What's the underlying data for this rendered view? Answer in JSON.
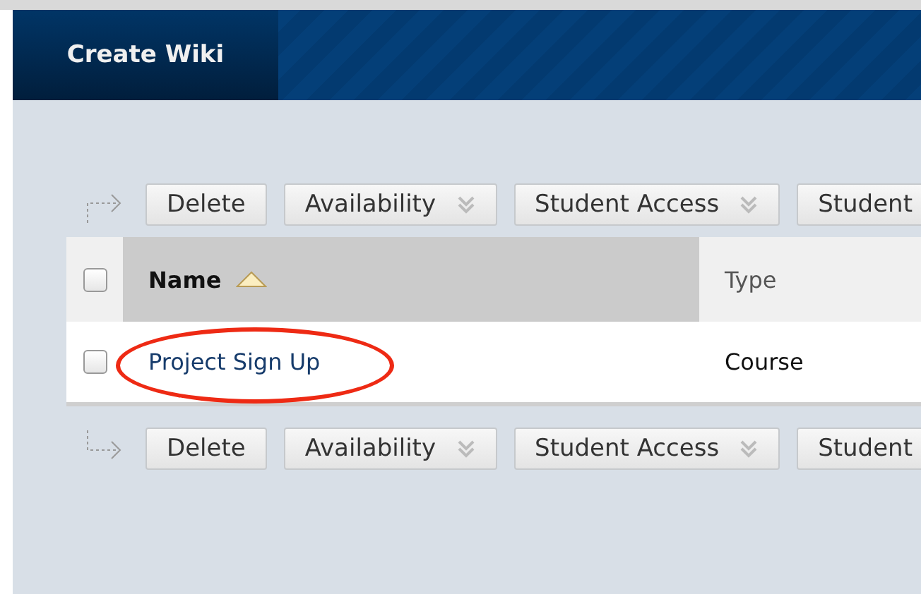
{
  "header": {
    "title": "Create Wiki"
  },
  "top_toolbar": [
    {
      "label": "Delete",
      "kind": "button"
    },
    {
      "label": "Availability",
      "kind": "menu"
    },
    {
      "label": "Student Access",
      "kind": "menu"
    },
    {
      "label": "Student",
      "kind": "button"
    }
  ],
  "table": {
    "select_all": {
      "checked": false
    },
    "columns": [
      {
        "label": "Name",
        "sorted": true
      },
      {
        "label": "Type",
        "sorted": false
      }
    ],
    "rows": [
      {
        "checked": false,
        "circled": true,
        "cells": [
          "Project Sign Up",
          "Course"
        ]
      }
    ]
  },
  "bottom_toolbar": [
    {
      "label": "Delete",
      "kind": "button"
    },
    {
      "label": "Availability",
      "kind": "menu"
    },
    {
      "label": "Student Access",
      "kind": "menu"
    },
    {
      "label": "Student",
      "kind": "button"
    }
  ]
}
